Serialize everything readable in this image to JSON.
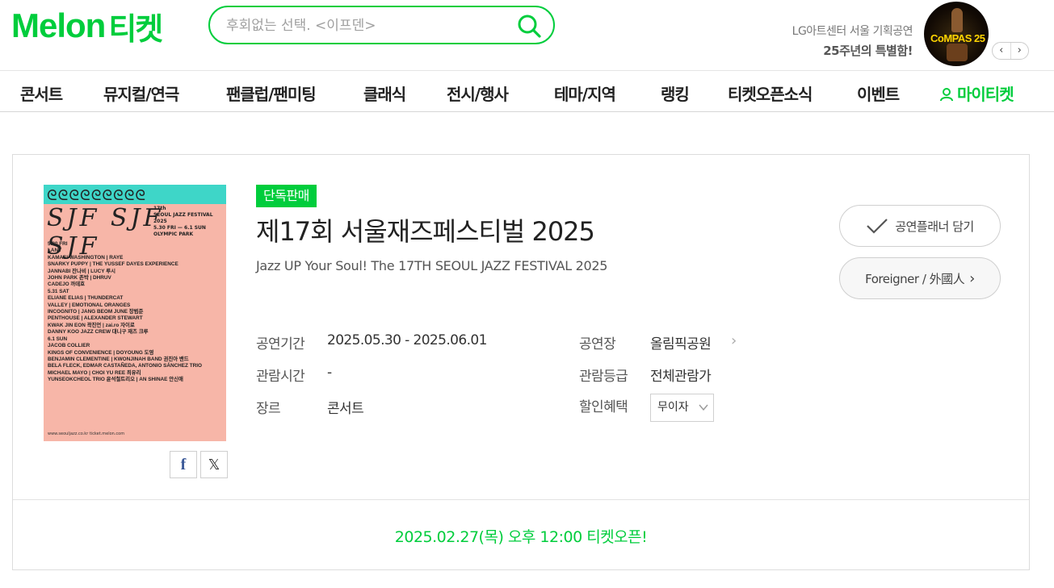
{
  "header": {
    "logo_text": "Melon",
    "logo_ticket": "티켓",
    "search_placeholder": "후회없는 선택. <이프덴>",
    "promo_line1": "LG아트센터 서울 기획공연",
    "promo_line2": "25주년의 특별함!",
    "promo_image_text": "CoMPAS 25"
  },
  "nav": {
    "items": [
      "콘서트",
      "뮤지컬/연극",
      "팬클럽/팬미팅",
      "클래식",
      "전시/행사",
      "테마/지역",
      "랭킹",
      "티켓오픈소식",
      "이벤트"
    ],
    "my_ticket": "마이티켓"
  },
  "performance": {
    "badge": "단독판매",
    "title": "제17회 서울재즈페스티벌 2025",
    "subtitle": "Jazz UP Your Soul! The 17TH SEOUL JAZZ FESTIVAL 2025",
    "info": {
      "period_label": "공연기간",
      "period_value": "2025.05.30 - 2025.06.01",
      "time_label": "관람시간",
      "time_value": "-",
      "genre_label": "장르",
      "genre_value": "콘서트",
      "venue_label": "공연장",
      "venue_value": "올림픽공원",
      "rating_label": "관람등급",
      "rating_value": "전체관람가",
      "discount_label": "할인혜택",
      "discount_value": "무이자"
    },
    "buttons": {
      "planner": "공연플래너 담기",
      "foreigner": "Foreigner / 外國人"
    },
    "open_notice": "2025.02.27(목) 오후 12:00 티켓오픈!"
  },
  "poster": {
    "sjf": "SJF SJF SJF",
    "meta": "17th\nSEOUL JAZZ FESTIVAL 2025\n5.30 FRI — 6.1 SUN\nOLYMPIC PARK",
    "lineup": "5.30 FRI\nLANY\nKAMASI WASHINGTON | RAYE\nSNARKY PUPPY | THE YUSSEF DAYES EXPERIENCE\nJANNABI 잔나비 | LUCY 루시\nJOHN PARK 존박 | DHRUV\nCADEJO 까데호\n5.31 SAT\nELIANE ELIAS | THUNDERCAT\nVALLEY | EMOTIONAL ORANGES\nINCOGNITO | JANG BEOM JUNE 장범준\nPENTHOUSE | ALEXANDER STEWART\nKWAK JIN EON 곽진언 | zai.ro 자이로\nDANNY KOO JAZZ CREW 대니구 재즈 크루\n6.1 SUN\nJACOB COLLIER\nKINGS OF CONVENIENCE | DOYOUNG 도영\nBENJAMIN CLEMENTINE | KWONJINAH BAND 권진아 밴드\nBELA FLECK, EDMAR CASTAÑEDA, ANTONIO SÁNCHEZ TRIO\nMICHAEL MAYO | CHOI YU REE 최유리\nYUNSEOKCHEOL TRIO 윤석철트리오 | AN SHINAE 안신애",
    "footer": "www.seouljazz.co.kr    ticket.melon.com"
  },
  "colors": {
    "brand": "#00cd3c",
    "poster_bg": "#f7b6a8",
    "poster_band": "#3ed6c8"
  }
}
